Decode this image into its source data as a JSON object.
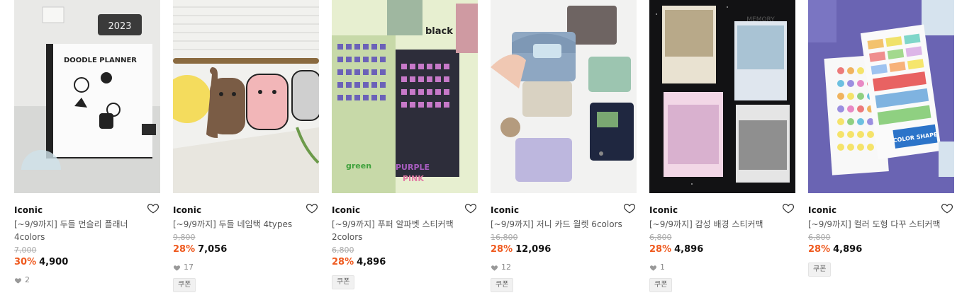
{
  "products": [
    {
      "brand": "Iconic",
      "title": "[~9/9까지] 두들 먼슬리 플래너 4colors",
      "original_price": "7,000",
      "discount_rate": "30%",
      "price": "4,900",
      "likes": "2",
      "coupon": "",
      "image_text": "DOODLE PLANNER"
    },
    {
      "brand": "Iconic",
      "title": "[~9/9까지] 두들 네임택 4types",
      "original_price": "9,800",
      "discount_rate": "28%",
      "price": "7,056",
      "likes": "17",
      "coupon": "쿠폰",
      "image_text": ""
    },
    {
      "brand": "Iconic",
      "title": "[~9/9까지] 푸퍼 알파벳 스티커팩 2colors",
      "original_price": "6,800",
      "discount_rate": "28%",
      "price": "4,896",
      "likes": "",
      "coupon": "쿠폰",
      "image_text": "black"
    },
    {
      "brand": "Iconic",
      "title": "[~9/9까지] 저니 카드 월렛 6colors",
      "original_price": "16,800",
      "discount_rate": "28%",
      "price": "12,096",
      "likes": "12",
      "coupon": "쿠폰",
      "image_text": ""
    },
    {
      "brand": "Iconic",
      "title": "[~9/9까지] 감성 배경 스티커팩",
      "original_price": "6,800",
      "discount_rate": "28%",
      "price": "4,896",
      "likes": "1",
      "coupon": "쿠폰",
      "image_text": "MEMORY"
    },
    {
      "brand": "Iconic",
      "title": "[~9/9까지] 컬러 도형 다꾸 스티커팩",
      "original_price": "6,800",
      "discount_rate": "28%",
      "price": "4,896",
      "likes": "",
      "coupon": "쿠폰",
      "image_text": "COLOR SHAPE"
    }
  ],
  "colors": {
    "discount": "#ef5a1f",
    "price": "#111111",
    "muted": "#aaaaaa"
  }
}
